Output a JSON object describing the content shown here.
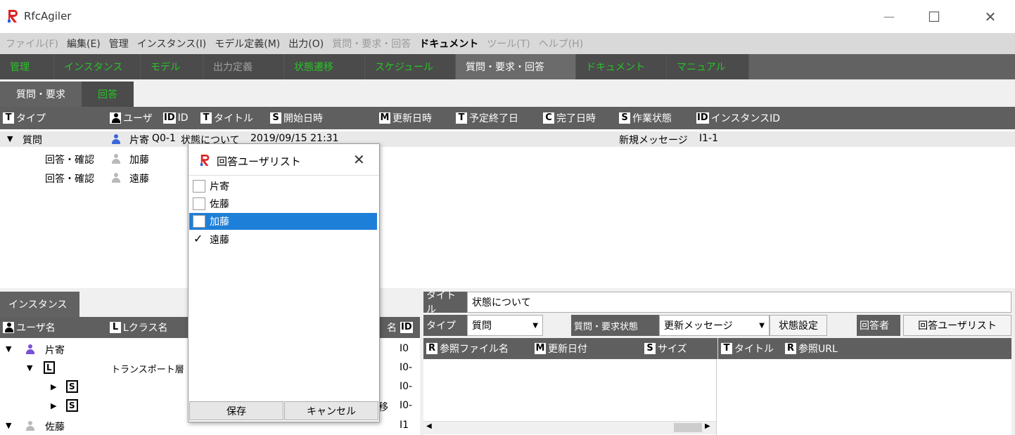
{
  "window": {
    "title": "RfcAgiler",
    "minimize": "—",
    "maximize": "☐",
    "close": "✕"
  },
  "menu": [
    {
      "label": "ファイル(F)",
      "style": "gray"
    },
    {
      "label": "編集(E)",
      "style": "dark"
    },
    {
      "label": "管理",
      "style": "dark"
    },
    {
      "label": "インスタンス(I)",
      "style": "dark"
    },
    {
      "label": "モデル定義(M)",
      "style": "dark"
    },
    {
      "label": "出力(O)",
      "style": "dark"
    },
    {
      "label": "質問・要求・回答",
      "style": "gray"
    },
    {
      "label": "ドキュメント",
      "style": "bold"
    },
    {
      "label": "ツール(T)",
      "style": "gray"
    },
    {
      "label": "ヘルプ(H)",
      "style": "gray"
    }
  ],
  "nav_tabs": [
    {
      "label": "管理",
      "state": "green"
    },
    {
      "label": "インスタンス",
      "state": "green"
    },
    {
      "label": "モデル",
      "state": "green"
    },
    {
      "label": "出力定義",
      "state": "dim"
    },
    {
      "label": "状態遷移",
      "state": "green"
    },
    {
      "label": "スケジュール",
      "state": "green"
    },
    {
      "label": "質問・要求・回答",
      "state": "selected"
    },
    {
      "label": "ドキュメント",
      "state": "green"
    },
    {
      "label": "マニュアル",
      "state": "green"
    }
  ],
  "sub_tabs": {
    "a": "質問・要求",
    "b": "回答"
  },
  "main_table": {
    "headers": {
      "type": "タイプ",
      "user": "ユーザ",
      "id": "ID",
      "title": "タイトル",
      "start": "開始日時",
      "updated": "更新日時",
      "planned_end": "予定終了日",
      "completed": "完了日時",
      "work_state": "作業状態",
      "instance_id": "インスタンスID"
    },
    "header_icons": {
      "T": "T",
      "S": "S",
      "M": "M",
      "C": "C",
      "ID": "ID"
    },
    "rows": [
      {
        "type": "質問",
        "user": "片寄",
        "id": "Q0-1",
        "title": "状態について",
        "start": "2019/09/15 21:31",
        "work_state": "新規メッセージ",
        "instance_id": "I1-1"
      },
      {
        "type": "回答・確認",
        "user": "加藤"
      },
      {
        "type": "回答・確認",
        "user": "遠藤"
      }
    ]
  },
  "instance_panel": {
    "tab": "インスタンス",
    "headers": {
      "user_name": "ユーザ名",
      "lclass": "Lクラス名",
      "name_tail": "名",
      "id": "ID"
    },
    "icons": {
      "L": "L",
      "S": "S"
    },
    "rows": [
      {
        "label": "片寄",
        "id": "I0"
      },
      {
        "label": "L",
        "text": "トランスポート層",
        "id": "I0-"
      },
      {
        "label": "S",
        "id": "I0-"
      },
      {
        "label": "S",
        "tail": "移",
        "id": "I0-"
      },
      {
        "label": "佐藤",
        "id": "I1"
      }
    ]
  },
  "detail": {
    "title_label": "タイトル",
    "title_value": "状態について",
    "type_label": "タイプ",
    "type_value": "質問",
    "status_label": "質問・要求状態",
    "status_value": "更新メッセージ",
    "set_status_button": "状態設定",
    "answerer_label": "回答者",
    "answer_user_list_button": "回答ユーザリスト",
    "files_headers": {
      "ref_file": "参照ファイル名",
      "updated": "更新日付",
      "size": "サイズ",
      "title": "タイトル",
      "url": "参照URL"
    },
    "icons": {
      "R": "R",
      "M": "M",
      "S": "S",
      "T": "T"
    }
  },
  "dialog": {
    "title": "回答ユーザリスト",
    "close": "✕",
    "items": [
      {
        "label": "片寄",
        "checked": false,
        "selected": false
      },
      {
        "label": "佐藤",
        "checked": false,
        "selected": false
      },
      {
        "label": "加藤",
        "checked": false,
        "selected": true
      },
      {
        "label": "遠藤",
        "checked": true,
        "selected": false
      }
    ],
    "save": "保存",
    "cancel": "キャンセル"
  },
  "colors": {
    "accent_green": "#27c427",
    "dark_header": "#5f5f5f",
    "selection_blue": "#1e7fd8",
    "user_blue": "#3a68d8",
    "logo_red": "#d22"
  }
}
